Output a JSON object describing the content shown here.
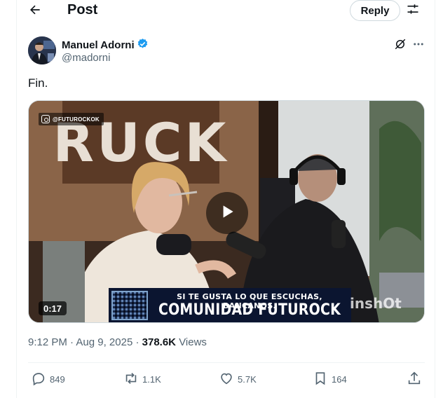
{
  "header": {
    "title": "Post",
    "reply_label": "Reply"
  },
  "author": {
    "name": "Manuel Adorni",
    "handle": "@madorni",
    "verified": true,
    "verified_color": "#1d9bf0"
  },
  "post": {
    "text": "Fin."
  },
  "media": {
    "type": "video",
    "watermark": "@FUTUROCKOK",
    "background_sign": "RUCK",
    "banner_subtitle": "SI TE GUSTA LO QUE ESCUCHAS, BANCANOS.",
    "banner_title": "COMUNIDAD FUTUROCK",
    "editor_watermark": "inshOt",
    "duration": "0:17"
  },
  "meta": {
    "time": "9:12 PM",
    "separator": "·",
    "date": "Aug 9, 2025",
    "views_count": "378.6K",
    "views_label": "Views"
  },
  "actions": {
    "replies": "849",
    "reposts": "1.1K",
    "likes": "5.7K",
    "bookmarks": "164"
  },
  "icons": {
    "back": "arrow-left-icon",
    "tune": "sliders-icon",
    "grok": "grok-icon",
    "more": "more-horizontal-icon",
    "reply": "comment-icon",
    "repost": "repost-icon",
    "like": "heart-icon",
    "bookmark": "bookmark-icon",
    "share": "share-icon",
    "play": "play-icon"
  }
}
